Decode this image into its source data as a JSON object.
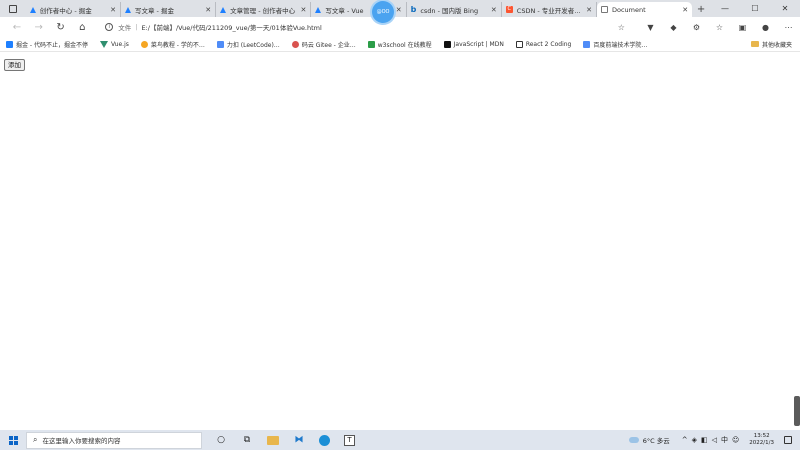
{
  "tabs": [
    {
      "label": "创作者中心 - 掘金",
      "icon": "juejin-icon",
      "active": false
    },
    {
      "label": "写文章 - 掘金",
      "icon": "juejin-icon",
      "active": false
    },
    {
      "label": "文章管理 - 创作者中心",
      "icon": "juejin-icon",
      "active": false
    },
    {
      "label": "写文章 - Vue",
      "icon": "juejin-icon",
      "active": false
    },
    {
      "label": "csdn - 国内版 Bing",
      "icon": "bing-icon",
      "active": false
    },
    {
      "label": "CSDN - 专业开发者社区",
      "icon": "csdn-icon",
      "active": false
    },
    {
      "label": "Document",
      "icon": "document-icon",
      "active": true
    }
  ],
  "avatar_bubble_text": "@OO",
  "address": {
    "scheme_label": "文件",
    "url": "E:/【前端】/Vue/代码/211209_vue/第一天/01体验Vue.html"
  },
  "bookmarks": [
    {
      "label": "掘金 - 代码不止，掘金不停",
      "icon": "juejin-icon",
      "color": "#1e80ff"
    },
    {
      "label": "Vue.js",
      "icon": "vue-icon",
      "color": "#2f8f6f"
    },
    {
      "label": "菜鸟教程 - 学的不…",
      "icon": "runoob-icon",
      "color": "#f5a623"
    },
    {
      "label": "力扣 (LeetCode)…",
      "icon": "leetcode-icon",
      "color": "#4f8cf7"
    },
    {
      "label": "码云 Gitee - 企业…",
      "icon": "gitee-icon",
      "color": "#d9534f"
    },
    {
      "label": "w3school 在线教程",
      "icon": "w3school-icon",
      "color": "#2b9d48"
    },
    {
      "label": "JavaScript | MDN",
      "icon": "mdn-icon",
      "color": "#111111"
    },
    {
      "label": "React 2 Coding",
      "icon": "page-icon",
      "color": "#333333"
    },
    {
      "label": "百度前端技术学院…",
      "icon": "baidu-icon",
      "color": "#4f8cf7"
    }
  ],
  "bookmarks_other": "其他收藏夹",
  "page": {
    "button_label": "添加"
  },
  "taskbar": {
    "search_placeholder": "在这里输入你要搜索的内容",
    "weather": "6°C 多云",
    "time": "13:52",
    "date": "2022/1/3"
  }
}
